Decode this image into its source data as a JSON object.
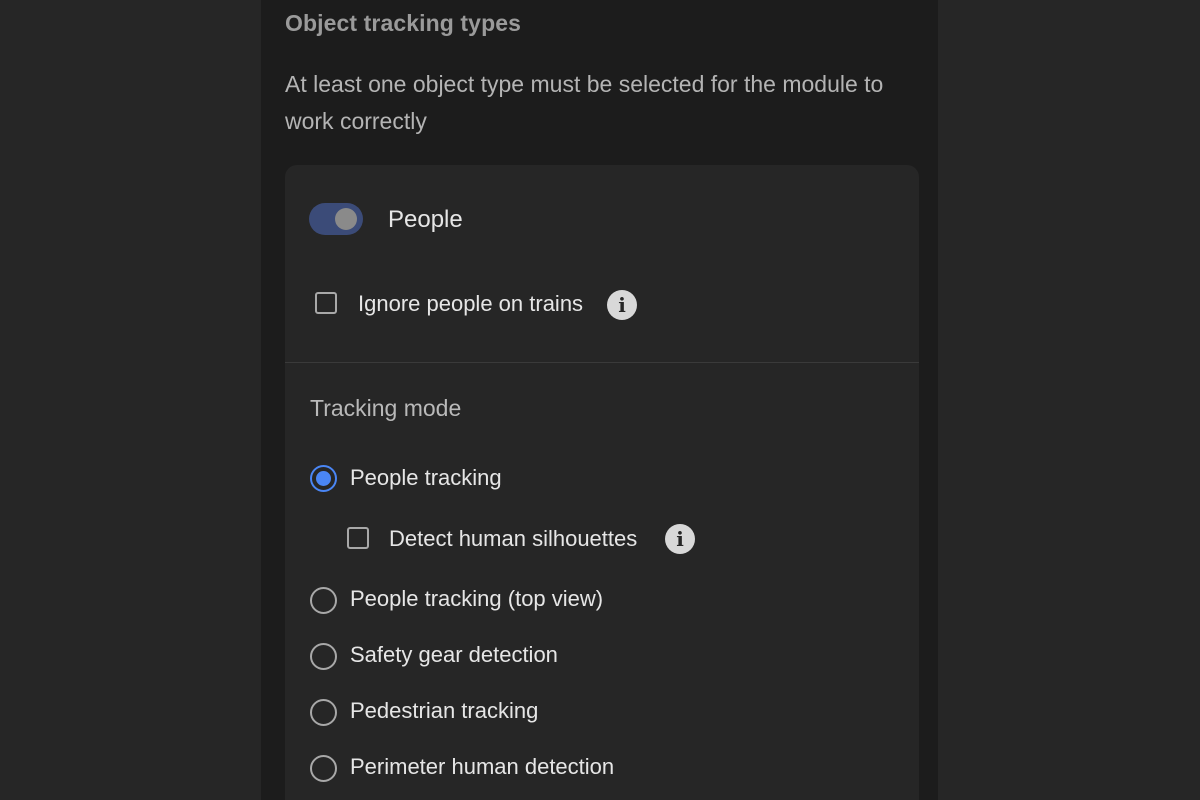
{
  "section": {
    "title": "Object tracking types",
    "description": "At least one object type must be selected for the module to work correctly"
  },
  "people": {
    "toggle_label": "People",
    "toggle_on": true,
    "ignore_trains_label": "Ignore people on trains",
    "ignore_trains_checked": false
  },
  "tracking_mode": {
    "heading": "Tracking mode",
    "options": [
      {
        "label": "People tracking",
        "selected": true
      },
      {
        "label": "People tracking (top view)",
        "selected": false
      },
      {
        "label": "Safety gear detection",
        "selected": false
      },
      {
        "label": "Pedestrian tracking",
        "selected": false
      },
      {
        "label": "Perimeter human detection",
        "selected": false
      }
    ],
    "detect_silhouettes_label": "Detect human silhouettes",
    "detect_silhouettes_checked": false
  },
  "icons": {
    "info_glyph": "i"
  },
  "colors": {
    "accent": "#4a86f5",
    "toggle_track": "#3b4b78",
    "panel_bg": "#1c1c1c",
    "card_bg": "#262626"
  }
}
